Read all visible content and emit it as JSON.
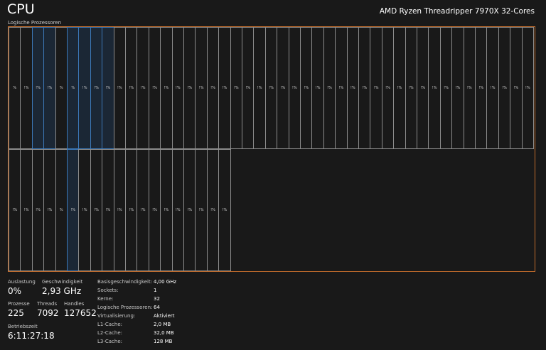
{
  "header": {
    "title": "CPU",
    "cpu_model": "AMD Ryzen Threadripper 7970X 32-Cores"
  },
  "grid": {
    "label": "Logische Prozessoren",
    "row1_count": 45,
    "row2_count": 19,
    "selected_row1": [
      2,
      3,
      5,
      6,
      7,
      8
    ],
    "selected_row2": [
      5
    ],
    "processors": [
      {
        "label": "%"
      },
      {
        "label": "!%"
      },
      {
        "label": "!%"
      },
      {
        "label": "!%"
      },
      {
        "label": "%"
      },
      {
        "label": "%"
      },
      {
        "label": "!%"
      },
      {
        "label": "!%"
      },
      {
        "label": "!%"
      },
      {
        "label": "!%"
      },
      {
        "label": "!%"
      },
      {
        "label": "!%"
      },
      {
        "label": "!%"
      },
      {
        "label": "!%"
      },
      {
        "label": "!%"
      },
      {
        "label": "!%"
      },
      {
        "label": "!%"
      },
      {
        "label": "!%"
      },
      {
        "label": "!%"
      },
      {
        "label": "!%"
      },
      {
        "label": "!%"
      },
      {
        "label": "!%"
      },
      {
        "label": "!%"
      },
      {
        "label": "!%"
      },
      {
        "label": "!%"
      },
      {
        "label": "!%"
      },
      {
        "label": "!%"
      },
      {
        "label": "!%"
      },
      {
        "label": "!%"
      },
      {
        "label": "!%"
      },
      {
        "label": "!%"
      },
      {
        "label": "!%"
      },
      {
        "label": "!%"
      },
      {
        "label": "!%"
      },
      {
        "label": "!%"
      },
      {
        "label": "!%"
      },
      {
        "label": "!%"
      },
      {
        "label": "!%"
      },
      {
        "label": "!%"
      },
      {
        "label": "!%"
      },
      {
        "label": "!%"
      },
      {
        "label": "!%"
      },
      {
        "label": "!%"
      },
      {
        "label": "!%"
      },
      {
        "label": "!%"
      },
      {
        "label": "!%"
      },
      {
        "label": "!%"
      },
      {
        "label": "!%"
      },
      {
        "label": "!%"
      },
      {
        "label": "%"
      },
      {
        "label": "!%"
      },
      {
        "label": "!%"
      },
      {
        "label": "!%"
      },
      {
        "label": "!%"
      },
      {
        "label": "!%"
      },
      {
        "label": "!%"
      },
      {
        "label": "!%"
      },
      {
        "label": "!%"
      },
      {
        "label": "!%"
      },
      {
        "label": "!%"
      },
      {
        "label": "!%"
      },
      {
        "label": "!%"
      },
      {
        "label": "!%"
      },
      {
        "label": "!%"
      }
    ]
  },
  "stats": {
    "auslastung_label": "Auslastung",
    "auslastung_value": "0%",
    "geschwindigkeit_label": "Geschwindigkeit",
    "geschwindigkeit_value": "2,93 GHz",
    "prozesse_label": "Prozesse",
    "prozesse_value": "225",
    "threads_label": "Threads",
    "threads_value": "7092",
    "handles_label": "Handles",
    "handles_value": "127652",
    "betriebszeit_label": "Betriebszeit",
    "betriebszeit_value": "6:11:27:18"
  },
  "details": [
    {
      "key": "Basisgeschwindigkeit:",
      "value": "4,00 GHz"
    },
    {
      "key": "Sockets:",
      "value": "1"
    },
    {
      "key": "Kerne:",
      "value": "32"
    },
    {
      "key": "Logische Prozessoren:",
      "value": "64"
    },
    {
      "key": "Virtualisierung:",
      "value": "Aktiviert"
    },
    {
      "key": "L1-Cache:",
      "value": "2,0 MB"
    },
    {
      "key": "L2-Cache:",
      "value": "32,0 MB"
    },
    {
      "key": "L3-Cache:",
      "value": "128 MB"
    }
  ]
}
